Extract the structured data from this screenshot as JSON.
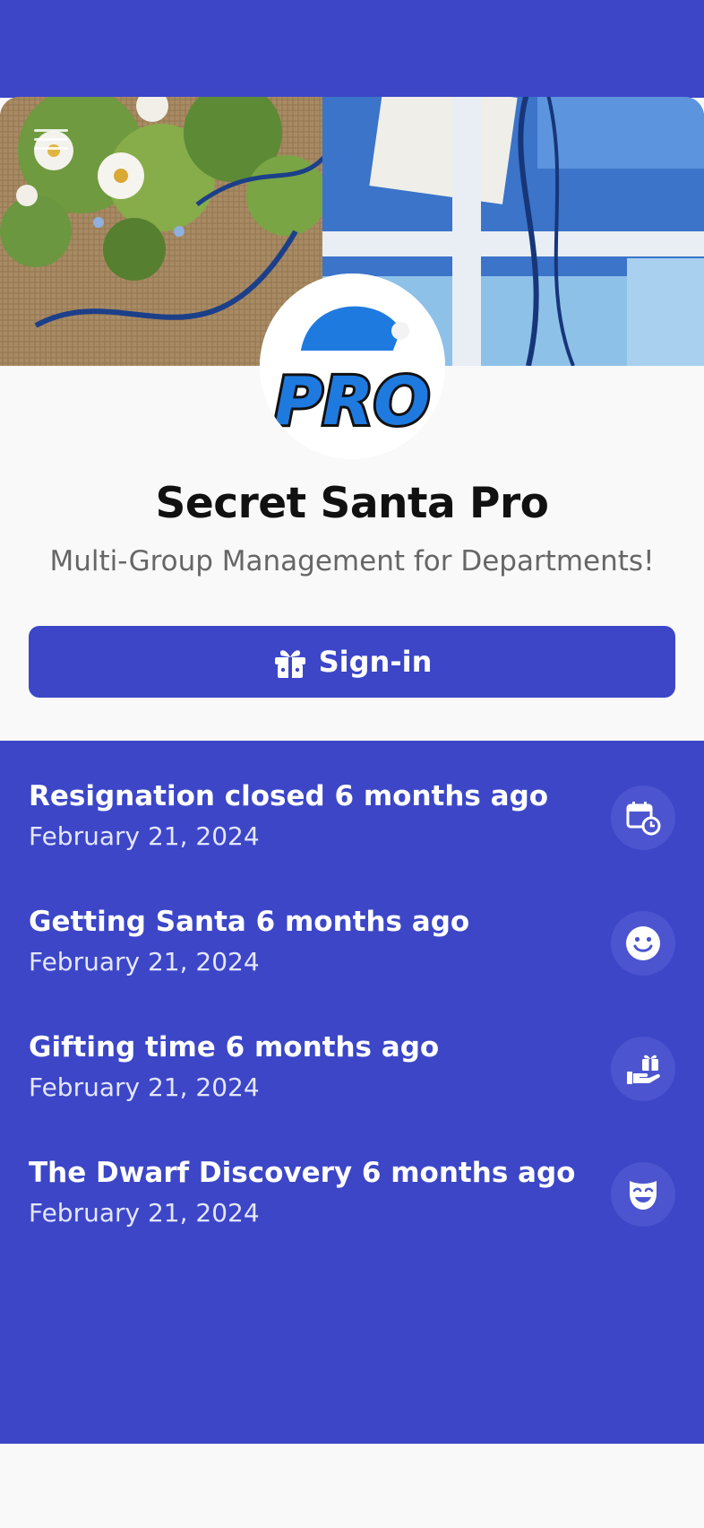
{
  "app": {
    "title": "Secret Santa Pro",
    "subtitle": "Multi-Group Management for Departments!",
    "logo_text": "PRO"
  },
  "header": {
    "menu_icon": "hamburger-menu-icon"
  },
  "signin": {
    "label": "Sign-in",
    "icon": "gift-icon"
  },
  "colors": {
    "primary": "#3c46c7",
    "icon_bg": "#4c55cf",
    "title_text": "#111111",
    "subtitle_text": "#666666",
    "page_bg": "#f9f9f9"
  },
  "events": [
    {
      "title": "Resignation closed 6 months ago",
      "date": "February 21, 2024",
      "icon": "calendar-clock-icon"
    },
    {
      "title": "Getting Santa 6 months ago",
      "date": "February 21, 2024",
      "icon": "smiley-face-icon"
    },
    {
      "title": "Gifting time 6 months ago",
      "date": "February 21, 2024",
      "icon": "hand-holding-gift-icon"
    },
    {
      "title": "The Dwarf Discovery 6 months ago",
      "date": "February 21, 2024",
      "icon": "masks-theater-icon"
    }
  ]
}
